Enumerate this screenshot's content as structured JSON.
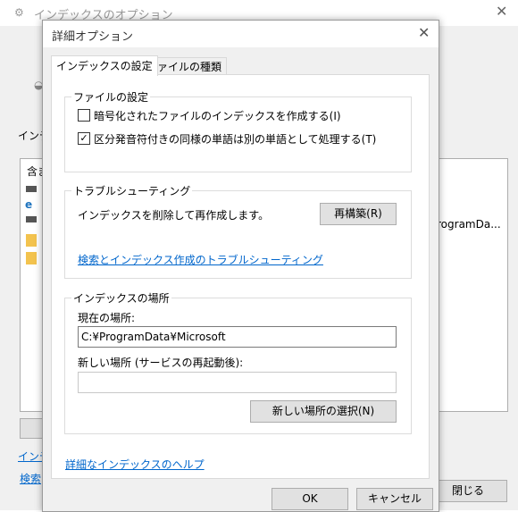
{
  "background_window": {
    "title": "インデックスのオプション",
    "truncated_label": "インデ",
    "list_col_truncated": "含ま",
    "right_text": "rogramDa...",
    "link1": "インデ",
    "link2": "検索",
    "close_button": "閉じる"
  },
  "dialog": {
    "title": "詳細オプション",
    "tabs": [
      {
        "label": "インデックスの設定",
        "active": true
      },
      {
        "label": "ファイルの種類",
        "active": false
      }
    ],
    "file_settings": {
      "legend": "ファイルの設定",
      "encrypt_label": "暗号化されたファイルのインデックスを作成する(I)",
      "encrypt_checked": false,
      "diacritics_label": "区分発音符付きの同様の単語は別の単語として処理する(T)",
      "diacritics_checked": true
    },
    "troubleshooting": {
      "legend": "トラブルシューティング",
      "rebuild_text": "インデックスを削除して再作成します。",
      "rebuild_button": "再構築(R)",
      "troubleshoot_link": "検索とインデックス作成のトラブルシューティング"
    },
    "index_location": {
      "legend": "インデックスの場所",
      "current_label": "現在の場所:",
      "current_value": "C:¥ProgramData¥Microsoft",
      "new_label": "新しい場所 (サービスの再起動後):",
      "new_value": "",
      "select_button": "新しい場所の選択(N)"
    },
    "help_link": "詳細なインデックスのヘルプ",
    "ok_button": "OK",
    "cancel_button": "キャンセル"
  }
}
